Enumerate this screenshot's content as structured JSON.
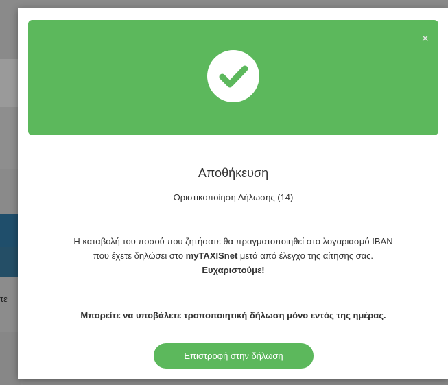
{
  "background": {
    "fragment_text": "τε"
  },
  "modal": {
    "close_glyph": "×",
    "icon": "check-circle-icon",
    "title": "Αποθήκευση",
    "subtitle": "Οριστικοποίηση Δήλωσης (14)",
    "message": {
      "line1": "Η καταβολή του ποσού που ζητήσατε θα πραγματοποιηθεί στο λογαριασμό IBAN",
      "line2_pre": "που έχετε δηλώσει στο ",
      "line2_brand": "myTAXISnet",
      "line2_post": " μετά από έλεγχο της αίτησης σας.",
      "thanks": "Ευχαριστούμε!"
    },
    "note": "Μπορείτε να υποβάλετε τροποποιητική δήλωση μόνο εντός της ημέρας.",
    "return_button_label": "Επιστροφή στην δήλωση"
  },
  "colors": {
    "success_green": "#5cb85c",
    "overlay": "#7f7f7f"
  }
}
